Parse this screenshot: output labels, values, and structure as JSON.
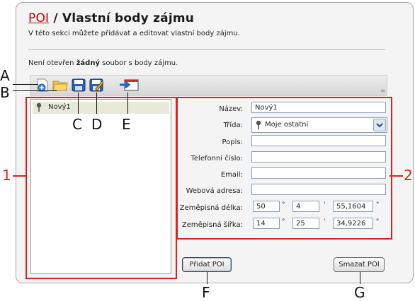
{
  "header": {
    "title_link": "POI",
    "title_separator": " / ",
    "title_rest": "Vlastní body zájmu",
    "subtitle": "V této sekci můžete přidávat a editovat vlastní body zájmu.",
    "status_prefix": "Není otevřen ",
    "status_bold": "žádný",
    "status_suffix": " soubor s body zájmu."
  },
  "toolbar": {
    "icons": [
      "new-file-icon",
      "open-folder-icon",
      "save-icon",
      "save-as-icon",
      "export-icon"
    ]
  },
  "tree": {
    "items": [
      {
        "label": "Nový1",
        "icon": "pin-icon"
      }
    ]
  },
  "form": {
    "name_label": "Název:",
    "name_value": "Nový1",
    "class_label": "Třída:",
    "class_value": "Moje ostatní",
    "desc_label": "Popis:",
    "desc_value": "",
    "phone_label": "Telefonní číslo:",
    "phone_value": "",
    "email_label": "Email:",
    "email_value": "",
    "web_label": "Webová adresa:",
    "web_value": "",
    "lon_label": "Zeměpisná délka:",
    "lon_deg": "50",
    "lon_min": "4",
    "lon_sec": "55,1604",
    "lat_label": "Zeměpisná šířka:",
    "lat_deg": "14",
    "lat_min": "25",
    "lat_sec": "34,9226",
    "deg_unit": "°",
    "min_unit": "'",
    "sec_unit": "\""
  },
  "buttons": {
    "add_label": "Přidat POI",
    "delete_label": "Smazat POI"
  },
  "annotations": {
    "A": "A",
    "B": "B",
    "C": "C",
    "D": "D",
    "E": "E",
    "F": "F",
    "G": "G",
    "one": "1",
    "two": "2"
  },
  "colors": {
    "highlight_red": "#e02020",
    "link_red": "#c00000"
  }
}
